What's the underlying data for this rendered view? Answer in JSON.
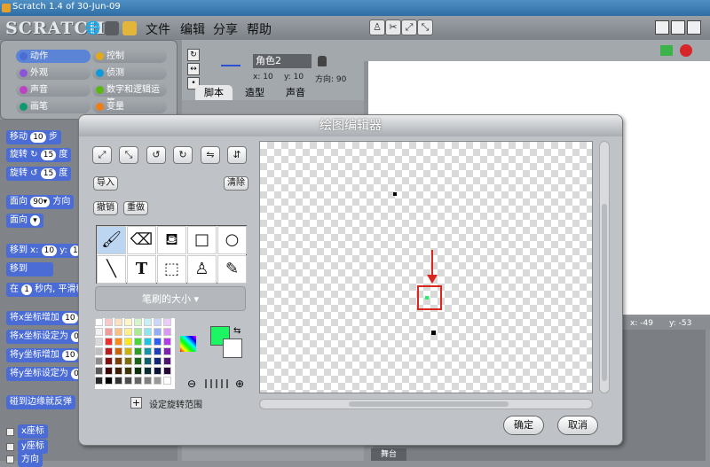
{
  "window": {
    "title": "Scratch 1.4 of 30-Jun-09"
  },
  "menubar": {
    "logo": "SCRATCH",
    "menus": [
      "文件",
      "编辑",
      "分享",
      "帮助"
    ]
  },
  "categories": [
    {
      "label": "动作",
      "color": "#4a6cd4"
    },
    {
      "label": "控制",
      "color": "#e1a91a"
    },
    {
      "label": "外观",
      "color": "#8a55d7"
    },
    {
      "label": "侦测",
      "color": "#0e9bd8"
    },
    {
      "label": "声音",
      "color": "#bb42c3"
    },
    {
      "label": "数字和逻辑运算",
      "color": "#5cb712"
    },
    {
      "label": "画笔",
      "color": "#0e9a6c"
    },
    {
      "label": "变量",
      "color": "#ee7d16"
    }
  ],
  "blocks": {
    "move": {
      "pre": "移动",
      "val": "10",
      "post": "步"
    },
    "turn_right": {
      "pre": "旋转 ↻",
      "val": "15",
      "post": "度"
    },
    "turn_left": {
      "pre": "旋转 ↺",
      "val": "15",
      "post": "度"
    },
    "point_dir": {
      "pre": "面向",
      "val": "90▾",
      "post": "方向"
    },
    "point_to": {
      "pre": "面向",
      "val": "▾"
    },
    "goto": {
      "pre": "移到 x:",
      "val": "10",
      "post": "y:",
      "val2": "1"
    },
    "goto_sprite": {
      "pre": "移到",
      "val": ""
    },
    "glide": {
      "pre": "在",
      "val": "1",
      "post": "秒内, 平滑移"
    },
    "change_x": {
      "pre": "将x坐标增加",
      "val": "10"
    },
    "set_x": {
      "pre": "将x坐标设定为",
      "val": "0"
    },
    "change_y": {
      "pre": "将y坐标增加",
      "val": "10"
    },
    "set_y": {
      "pre": "将y坐标设定为",
      "val": "0"
    },
    "bounce": {
      "label": "碰到边缘就反弹"
    },
    "xpos": {
      "label": "x座标"
    },
    "ypos": {
      "label": "y座标"
    },
    "direction": {
      "label": "方向"
    }
  },
  "sprite": {
    "name": "角色2",
    "x_label": "x:",
    "x": "10",
    "y_label": "y:",
    "y": "10",
    "dir_label": "方向:",
    "dir": "90",
    "tabs": [
      "脚本",
      "造型",
      "声音"
    ]
  },
  "stage": {
    "mouse_x_label": "x:",
    "mouse_x": "-49",
    "mouse_y_label": "y:",
    "mouse_y": "-53",
    "stage_label": "舞台"
  },
  "paint_editor": {
    "title": "绘图编辑器",
    "import": "导入",
    "clear": "清除",
    "undo": "撤销",
    "redo": "重做",
    "brush_size": "笔刷的大小 ▾",
    "set_rotation_center": "设定旋转范围",
    "ok": "确定",
    "cancel": "取消",
    "current_color": "#1ef562"
  }
}
